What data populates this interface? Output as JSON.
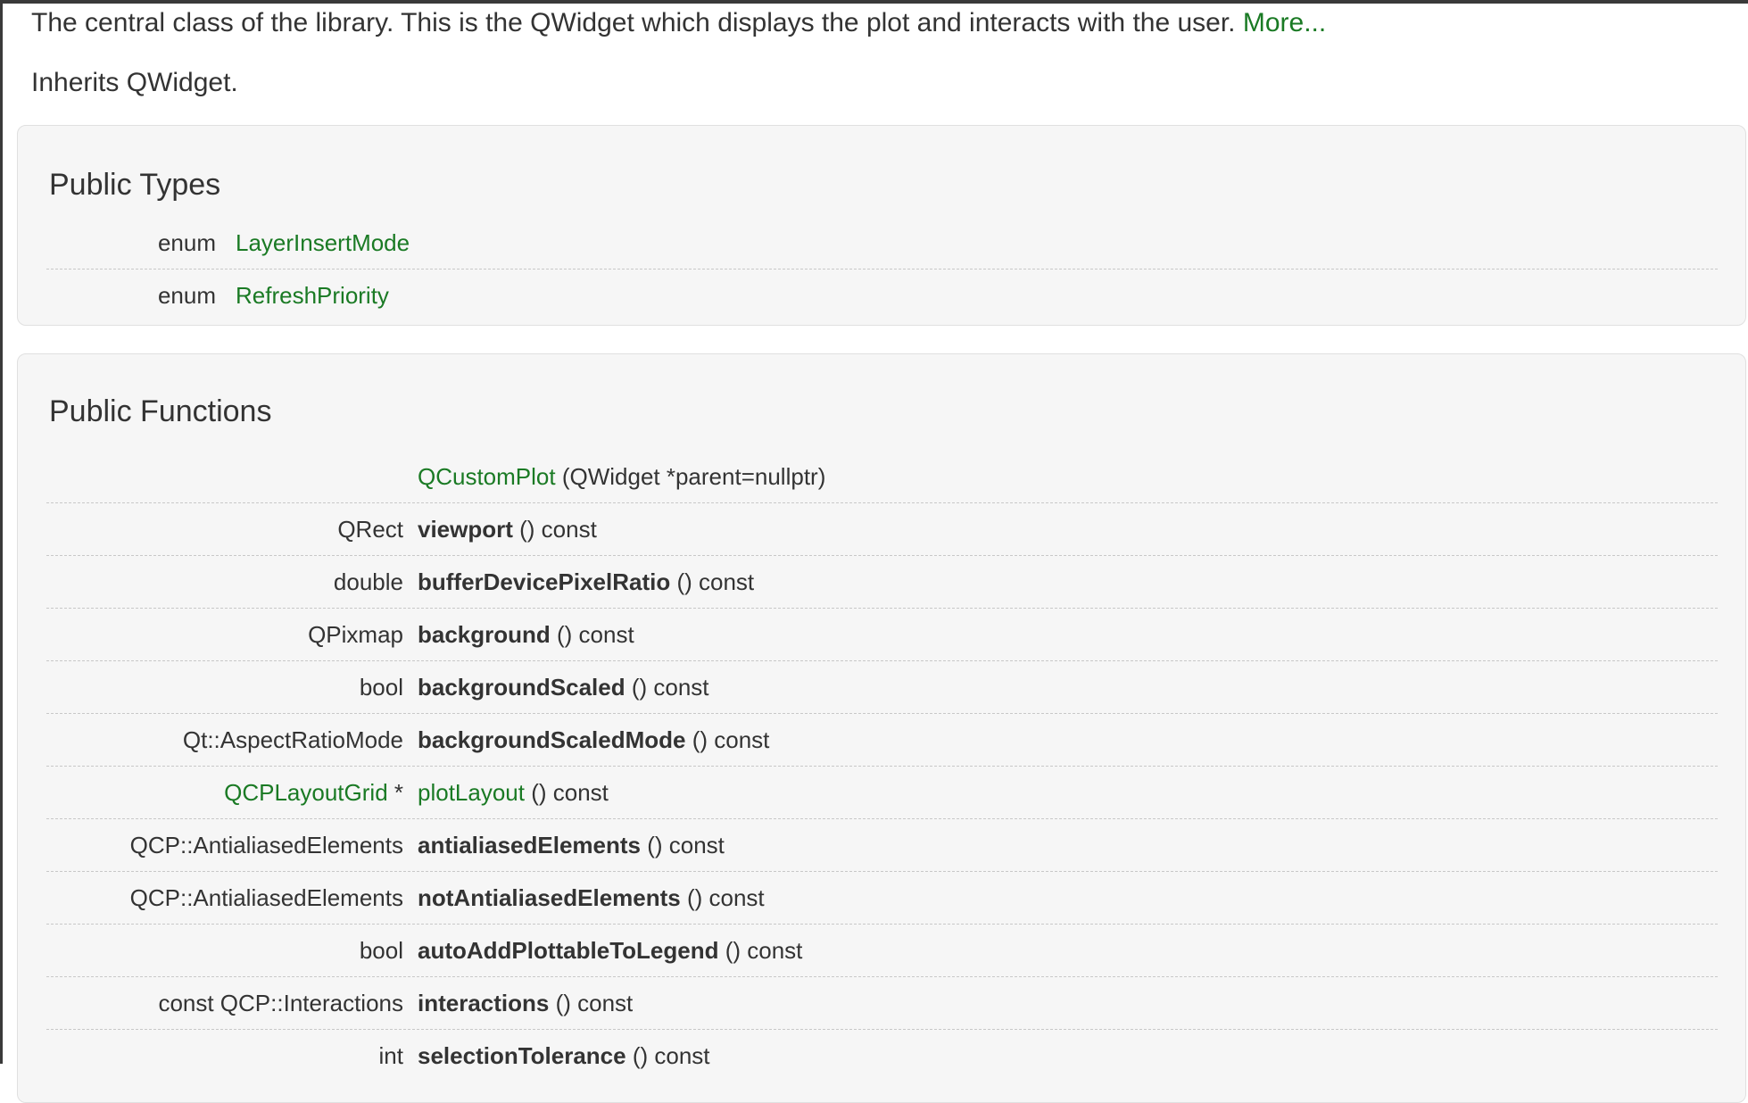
{
  "brief": {
    "text": "The central class of the library. This is the QWidget which displays the plot and interacts with the user.",
    "more_link": "More..."
  },
  "inherits": "Inherits QWidget.",
  "public_types": {
    "title": "Public Types",
    "rows": [
      {
        "kind": "enum",
        "name": "LayerInsertMode"
      },
      {
        "kind": "enum",
        "name": "RefreshPriority"
      }
    ]
  },
  "public_functions": {
    "title": "Public Functions",
    "rows": [
      {
        "ret": "",
        "ret_suffix": "",
        "name": "QCustomPlot",
        "args": " (QWidget *parent=nullptr)"
      },
      {
        "ret": "QRect",
        "ret_suffix": "",
        "name": "viewport",
        "args": " () const"
      },
      {
        "ret": "double",
        "ret_suffix": "",
        "name": "bufferDevicePixelRatio",
        "args": " () const"
      },
      {
        "ret": "QPixmap",
        "ret_suffix": "",
        "name": "background",
        "args": " () const"
      },
      {
        "ret": "bool",
        "ret_suffix": "",
        "name": "backgroundScaled",
        "args": " () const"
      },
      {
        "ret": "Qt::AspectRatioMode",
        "ret_suffix": "",
        "name": "backgroundScaledMode",
        "args": " () const"
      },
      {
        "ret": "QCPLayoutGrid",
        "ret_suffix": " *",
        "name": "plotLayout",
        "args": " () const"
      },
      {
        "ret": "QCP::AntialiasedElements",
        "ret_suffix": "",
        "name": "antialiasedElements",
        "args": " () const"
      },
      {
        "ret": "QCP::AntialiasedElements",
        "ret_suffix": "",
        "name": "notAntialiasedElements",
        "args": " () const"
      },
      {
        "ret": "bool",
        "ret_suffix": "",
        "name": "autoAddPlottableToLegend",
        "args": " () const"
      },
      {
        "ret": "const QCP::Interactions",
        "ret_suffix": "",
        "name": "interactions",
        "args": " () const"
      },
      {
        "ret": "int",
        "ret_suffix": "",
        "name": "selectionTolerance",
        "args": " () const"
      }
    ]
  }
}
